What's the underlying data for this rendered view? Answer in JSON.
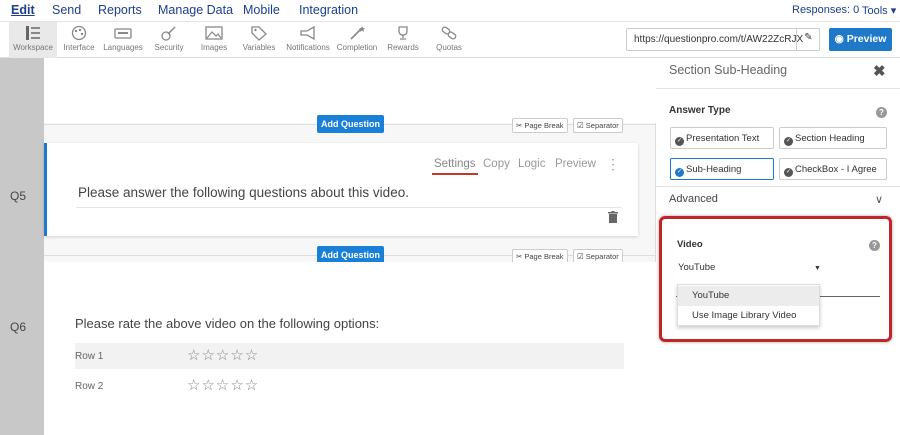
{
  "topmenu": {
    "items": [
      "Edit",
      "Send",
      "Reports",
      "Manage Data",
      "Mobile",
      "Integration"
    ],
    "responses": "Responses: 0",
    "tools": "Tools ▾"
  },
  "toolbar": {
    "tools": [
      {
        "label": "Workspace",
        "icon": "workspace-icon"
      },
      {
        "label": "Interface",
        "icon": "palette-icon"
      },
      {
        "label": "Languages",
        "icon": "keyboard-icon"
      },
      {
        "label": "Security",
        "icon": "guitar-icon"
      },
      {
        "label": "Images",
        "icon": "image-icon"
      },
      {
        "label": "Variables",
        "icon": "tag-icon"
      },
      {
        "label": "Notifications",
        "icon": "megaphone-icon"
      },
      {
        "label": "Completion",
        "icon": "wand-icon"
      },
      {
        "label": "Rewards",
        "icon": "trophy-icon"
      },
      {
        "label": "Quotas",
        "icon": "link-icon"
      }
    ],
    "url": "https://questionpro.com/t/AW22ZcRJX",
    "url_edit": "✎",
    "preview": "◉ Preview"
  },
  "canvas": {
    "add_question": "Add Question",
    "page_break": "✂ Page Break",
    "separator": "☑ Separator",
    "q5": {
      "number": "Q5",
      "actions": [
        "Settings",
        "Copy",
        "Logic",
        "Preview"
      ],
      "more": "⋮",
      "text": "Please answer the following questions about this video."
    },
    "q6": {
      "number": "Q6",
      "text": "Please rate the above video on the following options:",
      "rows": [
        "Row 1",
        "Row 2"
      ],
      "stars": "☆☆☆☆☆"
    }
  },
  "panel": {
    "title": "Section Sub-Heading",
    "close": "✖",
    "answer_type_label": "Answer Type",
    "help": "?",
    "options": [
      "Presentation Text",
      "Section Heading",
      "Sub-Heading",
      "CheckBox - I Agree"
    ],
    "selected_option": "Sub-Heading",
    "advanced": "Advanced",
    "chevron": "∨",
    "video_label": "Video",
    "video_value": "YouTube",
    "video_caret": "▼",
    "video_options": [
      "YouTube",
      "Use Image Library Video"
    ]
  }
}
